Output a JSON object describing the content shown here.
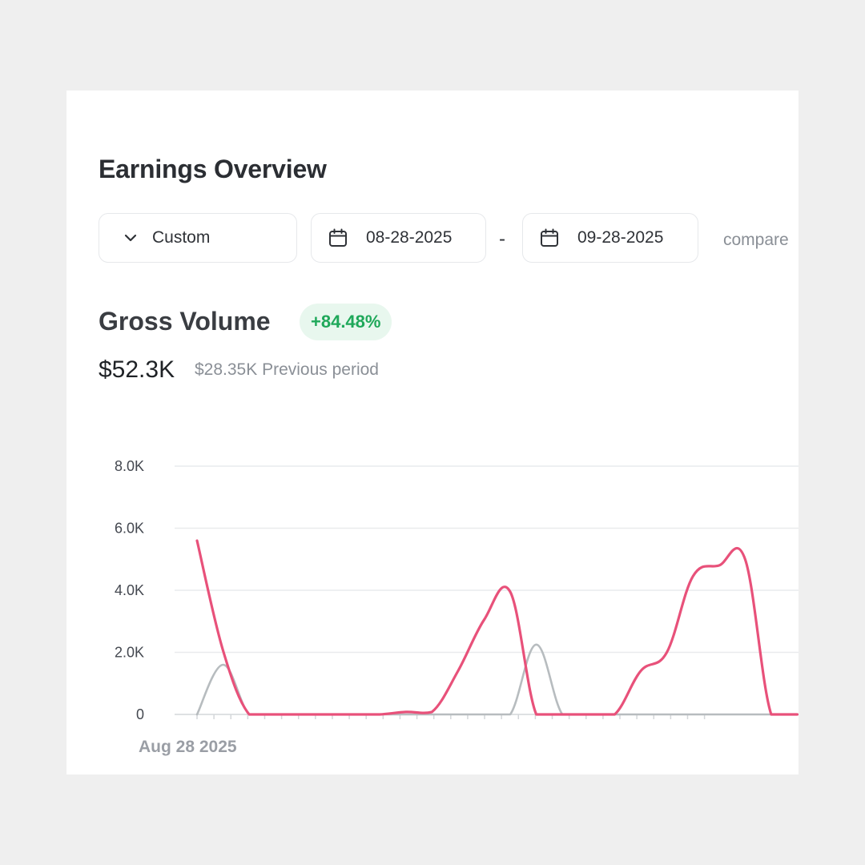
{
  "header": {
    "title": "Earnings Overview"
  },
  "filters": {
    "range_select": "Custom",
    "start_date": "08-28-2025",
    "separator": "-",
    "end_date": "09-28-2025",
    "compare_label": "compare"
  },
  "metric": {
    "title": "Gross Volume",
    "change": "+84.48%",
    "value": "$52.3K",
    "previous": "$28.35K Previous period"
  },
  "colors": {
    "current": "#e8517a",
    "previous": "#b7bcbf",
    "positive": "#1fa85a"
  },
  "chart_data": {
    "type": "line",
    "y_ticks": [
      "8.0K",
      "6.0K",
      "4.0K",
      "2.0K",
      "0"
    ],
    "ylim": [
      0,
      8000
    ],
    "x_label_first": "Aug 28 2025",
    "x_count": 31,
    "grid": true,
    "series": [
      {
        "role": "current",
        "values": [
          5600,
          2050,
          0,
          0,
          0,
          0,
          0,
          0,
          80,
          80,
          1400,
          3050,
          3950,
          0,
          0,
          0,
          0,
          1400,
          2000,
          4450,
          4800,
          5000,
          0,
          0
        ]
      },
      {
        "role": "previous",
        "values": [
          0,
          1600,
          0,
          0,
          0,
          0,
          0,
          0,
          0,
          0,
          0,
          0,
          0,
          2250,
          0,
          0,
          0,
          0,
          0,
          0,
          0,
          0,
          0,
          0
        ]
      }
    ]
  }
}
